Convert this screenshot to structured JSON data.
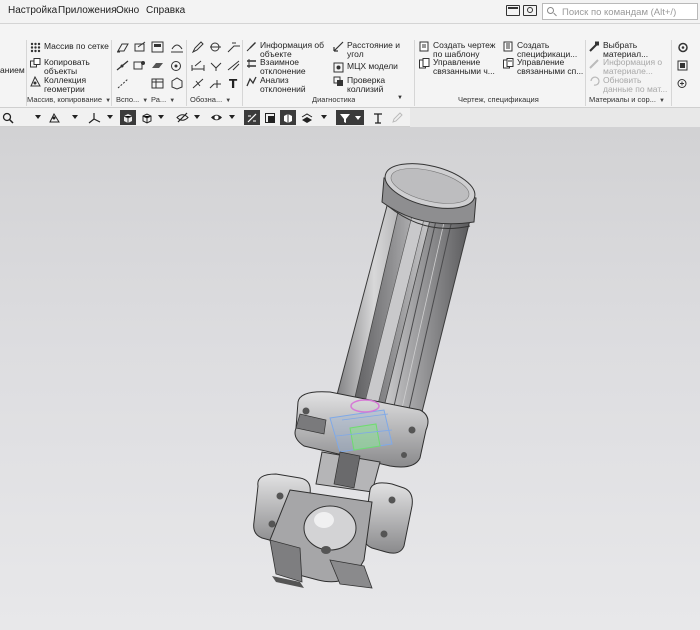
{
  "menubar": {
    "items": [
      "Настройка",
      "Приложения",
      "Окно",
      "Справка"
    ],
    "search_placeholder": "Поиск по командам (Alt+/)"
  },
  "ribbon": {
    "partial_left_label": "анием",
    "items": {
      "massiv_po_setke": "Массив по сетке",
      "kopirovat_obekty": [
        "Копировать",
        "объекты"
      ],
      "kollektsiya_geometrii": [
        "Коллекция",
        "геометрии"
      ],
      "informatsiya_ob_obekte": [
        "Информация об",
        "объекте"
      ],
      "vzaimnoe_otklonenie": [
        "Взаимное",
        "отклонение"
      ],
      "analiz_otkloneniy": [
        "Анализ",
        "отклонений"
      ],
      "rasstoyanie_i_ugol": [
        "Расстояние и",
        "угол"
      ],
      "mtsk_modeli": "МЦХ модели",
      "proverka_kolliziy": [
        "Проверка",
        "коллизий"
      ],
      "sozdat_chertezh": [
        "Создать чертеж",
        "по шаблону"
      ],
      "upravlenie_svyazannymi_ch": [
        "Управление",
        "связанными ч..."
      ],
      "sozdat_spetsifikatsiyu": [
        "Создать",
        "спецификаци..."
      ],
      "upravlenie_svyazannymi_sp": [
        "Управление",
        "связанными сп..."
      ],
      "vybrat_material": [
        "Выбрать",
        "материал..."
      ],
      "informatsiya_o_materiale": [
        "Информация о",
        "материале..."
      ],
      "obnovit_dannye": [
        "Обновить",
        "данные по мат..."
      ]
    },
    "groups": {
      "massiv": "Массив, копирование",
      "vspo": "Вспо...",
      "ra": "Ра...",
      "oboznach": "Обозна...",
      "diagnostika": "Диагностика",
      "chertezh": "Чертеж, спецификация",
      "materialy": "Материалы и сор..."
    }
  },
  "colors": {
    "accent_dark": "#3a3a3a",
    "viewport_top": "#d2d2d4",
    "viewport_bottom": "#e8e8ea",
    "part_metal": "#a9a9ab",
    "part_metal_light": "#dcdcdc",
    "part_metal_dark": "#5e5e60",
    "selection_blue": "#7fa9e8",
    "selection_green": "#6fdc6f",
    "selection_magenta": "#d67ad6"
  },
  "icons": [
    "search-icon",
    "camera-icon",
    "window-icon",
    "filter-icon",
    "eye-icon",
    "view-cube-icon"
  ]
}
